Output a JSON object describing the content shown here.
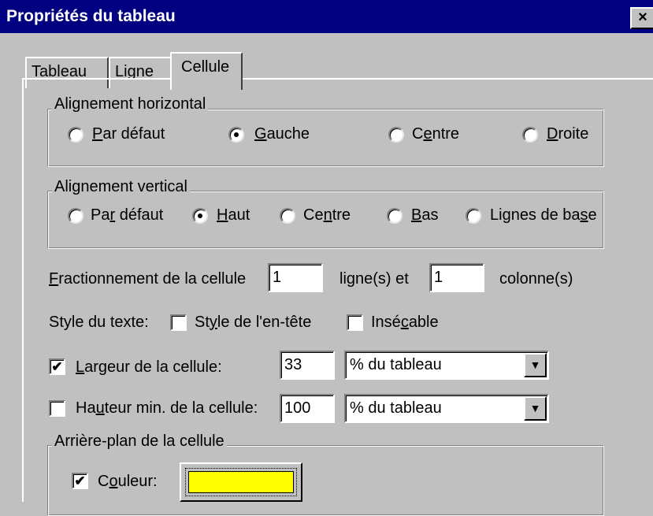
{
  "window": {
    "title": "Propriétés du tableau",
    "close_label": "×"
  },
  "tabs": [
    {
      "label": "Tableau",
      "active": false
    },
    {
      "label": "Ligne",
      "active": false
    },
    {
      "label": "Cellule",
      "active": true
    }
  ],
  "horizontal_alignment": {
    "legend": "Alignement horizontal",
    "selected": "Gauche",
    "options": [
      {
        "pre": "",
        "u": "P",
        "post": "ar défaut"
      },
      {
        "pre": "",
        "u": "G",
        "post": "auche"
      },
      {
        "pre": "C",
        "u": "e",
        "post": "ntre"
      },
      {
        "pre": "",
        "u": "D",
        "post": "roite"
      }
    ]
  },
  "vertical_alignment": {
    "legend": "Alignement vertical",
    "selected": "Haut",
    "options": [
      {
        "pre": "Pa",
        "u": "r",
        "post": " défaut"
      },
      {
        "pre": "",
        "u": "H",
        "post": "aut"
      },
      {
        "pre": "Ce",
        "u": "n",
        "post": "tre"
      },
      {
        "pre": "",
        "u": "B",
        "post": "as"
      },
      {
        "pre": "Lignes de ba",
        "u": "s",
        "post": "e"
      }
    ]
  },
  "split": {
    "label_u": "F",
    "label_post": "ractionnement de la cellule",
    "rows_value": "1",
    "middle_text": "ligne(s) et",
    "cols_value": "1",
    "end_text": "colonne(s)"
  },
  "text_style": {
    "label": "Style du texte:",
    "header_pre": "St",
    "header_u": "y",
    "header_post": "le de l'en-tête",
    "header_checked": false,
    "nowrap_pre": "Insé",
    "nowrap_u": "c",
    "nowrap_post": "able",
    "nowrap_checked": false
  },
  "width": {
    "checked": true,
    "check_glyph": "✔",
    "label_u": "L",
    "label_post": "argeur de la cellule:",
    "value": "33",
    "unit": "% du tableau",
    "arrow": "▼"
  },
  "height": {
    "checked": false,
    "label_pre": "Ha",
    "label_u": "u",
    "label_post": "teur min. de la cellule:",
    "value": "100",
    "unit": "% du tableau",
    "arrow": "▼"
  },
  "background": {
    "legend": "Arrière-plan de la cellule",
    "color_checked": true,
    "check_glyph": "✔",
    "color_label_pre": "C",
    "color_label_u": "o",
    "color_label_post": "uleur:",
    "swatch_color": "#ffff00"
  }
}
